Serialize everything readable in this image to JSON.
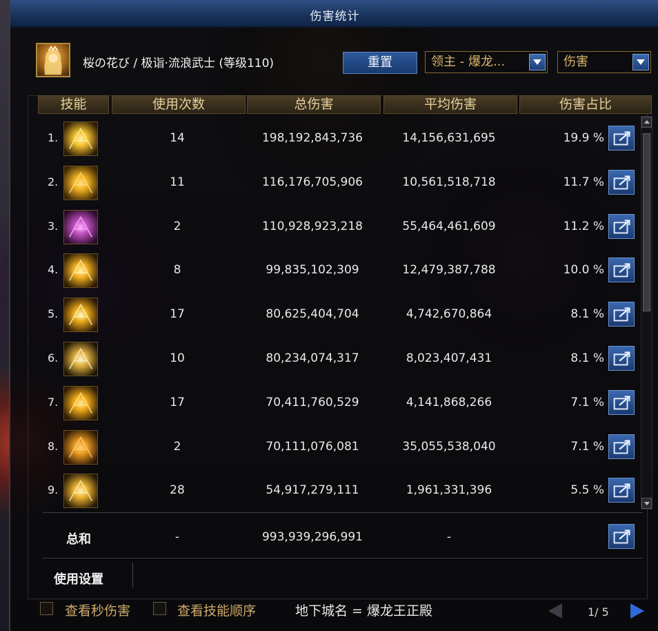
{
  "window": {
    "title": "伤害统计"
  },
  "character": {
    "name": "桜の花び / 极诣·流浪武士 (等级110)"
  },
  "controls": {
    "reset_label": "重置",
    "target_dropdown": "领主 - 爆龙...",
    "mode_dropdown": "伤害"
  },
  "table": {
    "headers": [
      "技能",
      "使用次数",
      "总伤害",
      "平均伤害",
      "伤害占比"
    ],
    "rows": [
      {
        "rank": "1.",
        "icon": "flame-burst-skill-icon",
        "uses": "14",
        "total": "198,192,843,736",
        "avg": "14,156,631,695",
        "pct": "19.9 %"
      },
      {
        "rank": "2.",
        "icon": "golden-swirl-skill-icon",
        "uses": "11",
        "total": "116,176,705,906",
        "avg": "10,561,518,718",
        "pct": "11.7 %"
      },
      {
        "rank": "3.",
        "icon": "purple-aura-skill-icon",
        "uses": "2",
        "total": "110,928,923,218",
        "avg": "55,464,461,609",
        "pct": "11.2 %"
      },
      {
        "rank": "4.",
        "icon": "lightning-slash-skill-icon",
        "uses": "8",
        "total": "99,835,102,309",
        "avg": "12,479,387,788",
        "pct": "10.0 %"
      },
      {
        "rank": "5.",
        "icon": "sword-flash-skill-icon",
        "uses": "17",
        "total": "80,625,404,704",
        "avg": "4,742,670,864",
        "pct": "8.1 %"
      },
      {
        "rank": "6.",
        "icon": "cross-slash-skill-icon",
        "uses": "10",
        "total": "80,234,074,317",
        "avg": "8,023,407,431",
        "pct": "8.1 %"
      },
      {
        "rank": "7.",
        "icon": "explosion-skill-icon",
        "uses": "17",
        "total": "70,411,760,529",
        "avg": "4,141,868,266",
        "pct": "7.1 %"
      },
      {
        "rank": "8.",
        "icon": "spiral-skill-icon",
        "uses": "2",
        "total": "70,111,076,081",
        "avg": "35,055,538,040",
        "pct": "7.1 %"
      },
      {
        "rank": "9.",
        "icon": "multi-slash-skill-icon",
        "uses": "28",
        "total": "54,917,279,111",
        "avg": "1,961,331,396",
        "pct": "5.5 %"
      }
    ]
  },
  "summary": {
    "label": "总和",
    "uses": "-",
    "total": "993,939,296,991",
    "avg": "-"
  },
  "settings": {
    "label": "使用设置",
    "options": [
      {
        "label": "查看秒伤害",
        "checked": false
      },
      {
        "label": "查看技能顺序",
        "checked": false
      }
    ],
    "dungeon": "地下城名 = 爆龙王正殿"
  },
  "pager": {
    "text": "1/ 5"
  },
  "colors": {
    "title_bar": "#1b355f",
    "header_gold": "#e6cf9a",
    "accent_gold": "#d9b46a",
    "button_blue": "#2d5a9a"
  }
}
